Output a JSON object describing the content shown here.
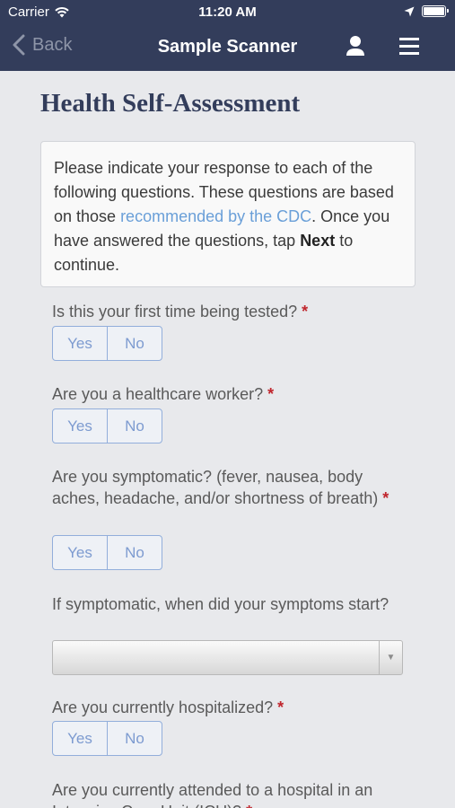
{
  "status_bar": {
    "carrier": "Carrier",
    "time": "11:20 AM"
  },
  "nav": {
    "back_label": "Back",
    "title": "Sample Scanner"
  },
  "page": {
    "title": "Health Self-Assessment",
    "intro": {
      "text_before": "Please indicate your response to each of the following questions. These questions are based on those ",
      "link": "recommended by the CDC",
      "text_middle": ". Once you have answered the questions, tap ",
      "next_word": "Next",
      "text_after": " to continue."
    }
  },
  "questions": [
    {
      "text": "Is this your first time being tested?",
      "required": "*",
      "yes": "Yes",
      "no": "No"
    },
    {
      "text": "Are you a healthcare worker?",
      "required": "*",
      "yes": "Yes",
      "no": "No"
    },
    {
      "text": "Are you symptomatic? (fever, nausea, body aches, headache, and/or shortness of breath)",
      "required": "*",
      "yes": "Yes",
      "no": "No"
    },
    {
      "text": "If symptomatic, when did your symptoms start?",
      "select_value": ""
    },
    {
      "text": "Are you currently hospitalized?",
      "required": "*",
      "yes": "Yes",
      "no": "No"
    },
    {
      "text": "Are you currently attended to a hospital in an Intensive Care Unit (ICU)?",
      "required": "*"
    }
  ],
  "colors": {
    "nav_bg": "#333d5b",
    "accent": "#7d9bd0",
    "required": "#c0262d",
    "link": "#6a9fd8"
  }
}
